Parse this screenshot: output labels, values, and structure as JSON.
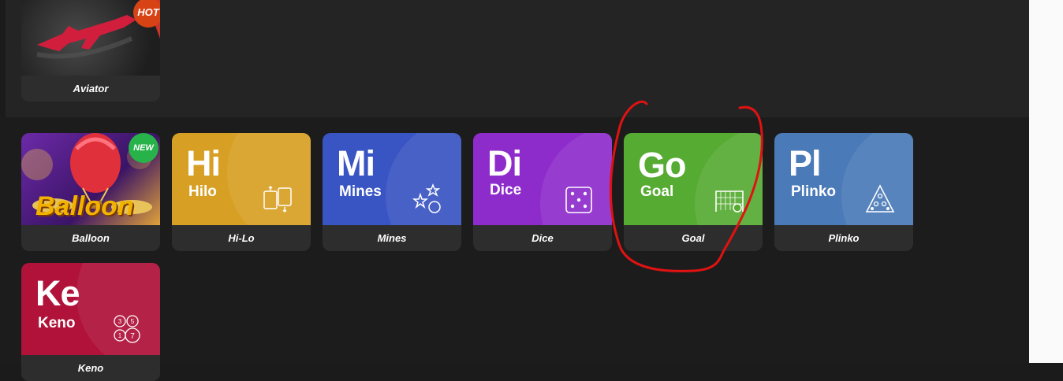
{
  "games": [
    {
      "id": "aviator",
      "label": "Aviator",
      "badge": "HOT"
    },
    {
      "id": "balloon",
      "label": "Balloon",
      "badge": "NEW",
      "art_text": "Balloon"
    },
    {
      "id": "hilo",
      "label": "Hi-Lo",
      "symbol": "Hi",
      "name": "Hilo",
      "color": "#d7a024",
      "icon": "playing-cards-icon"
    },
    {
      "id": "mines",
      "label": "Mines",
      "symbol": "Mi",
      "name": "Mines",
      "color": "#3954c3",
      "icon": "stars-bomb-icon"
    },
    {
      "id": "dice",
      "label": "Dice",
      "symbol": "Di",
      "name": "Dice",
      "color": "#8e2ccb",
      "icon": "dice-icon"
    },
    {
      "id": "goal",
      "label": "Goal",
      "symbol": "Go",
      "name": "Goal",
      "color": "#56ab33",
      "icon": "soccer-goal-icon"
    },
    {
      "id": "plinko",
      "label": "Plinko",
      "symbol": "Pl",
      "name": "Plinko",
      "color": "#4a7ab8",
      "icon": "plinko-pyramid-icon"
    },
    {
      "id": "keno",
      "label": "Keno",
      "symbol": "Ke",
      "name": "Keno",
      "color": "#b0123a",
      "icon": "keno-balls-icon"
    }
  ],
  "keno_balls": [
    "3",
    "5",
    "1",
    "7"
  ],
  "annotation_color": "#e01212"
}
